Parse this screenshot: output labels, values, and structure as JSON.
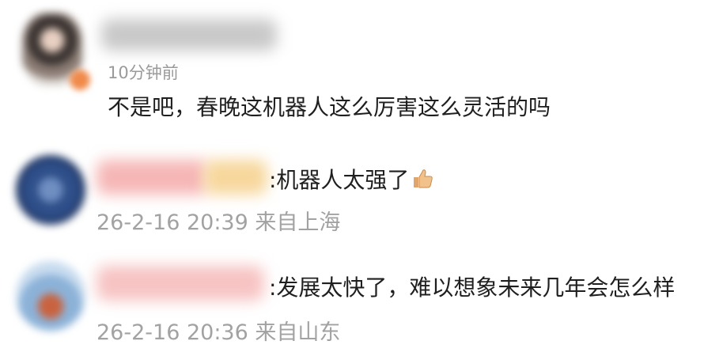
{
  "comments": [
    {
      "time": "10分钟前",
      "text": "不是吧，春晚这机器人这么厉害这么灵活的吗"
    },
    {
      "text": ":机器人太强了",
      "emoji": "thumbs-up-icon",
      "time": "26-2-16 20:39 来自上海"
    },
    {
      "text": ":发展太快了，难以想象未来几年会怎么样",
      "time": "26-2-16 20:36 来自山东"
    }
  ],
  "colors": {
    "text": "#1f1f1f",
    "meta": "#9a9a9a",
    "background": "#ffffff"
  }
}
